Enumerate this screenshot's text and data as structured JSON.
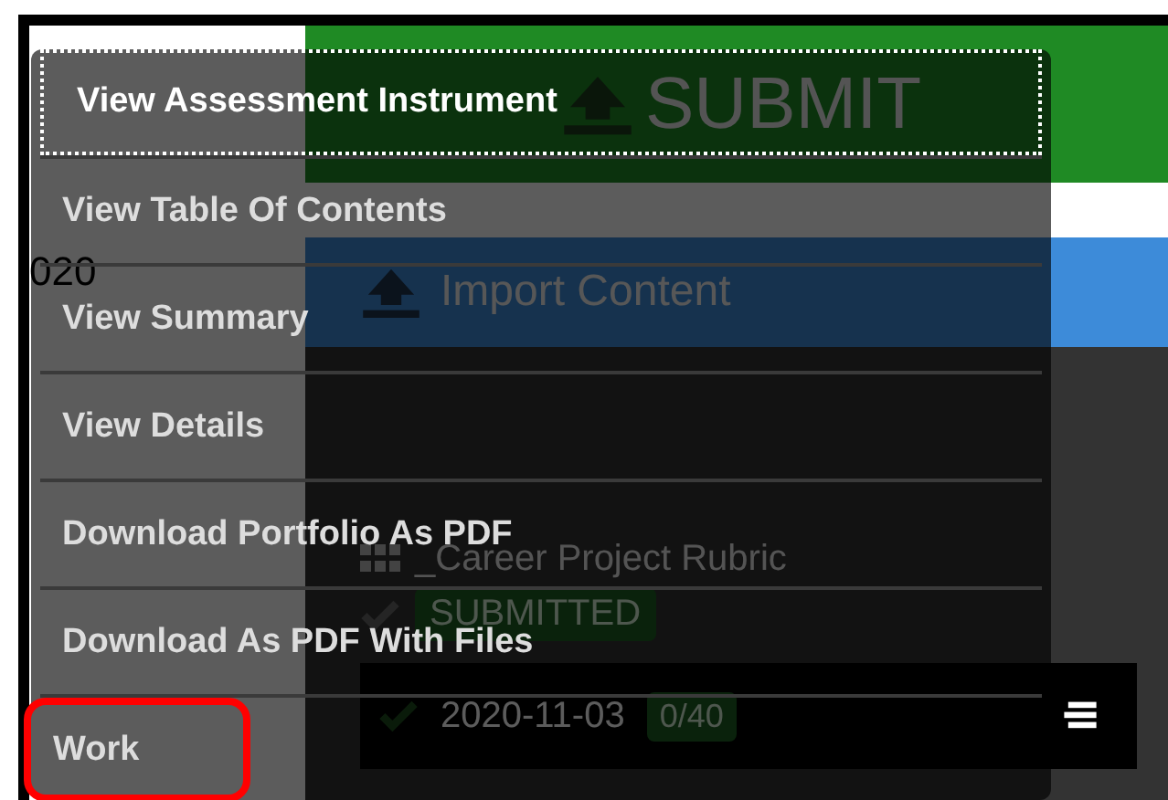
{
  "page": {
    "side_text": "020",
    "submit_button": "SUBMIT",
    "import_button": "Import Content",
    "rubric_title": "_Career Project Rubric",
    "status_badge": "SUBMITTED",
    "entry": {
      "date": "2020-11-03",
      "score": "0/40"
    }
  },
  "menu": {
    "items": [
      {
        "label": "View Assessment Instrument",
        "focused": true,
        "highlighted": false
      },
      {
        "label": "View Table Of Contents",
        "focused": false,
        "highlighted": false
      },
      {
        "label": "View Summary",
        "focused": false,
        "highlighted": false
      },
      {
        "label": "View Details",
        "focused": false,
        "highlighted": false
      },
      {
        "label": "Download Portfolio As PDF",
        "focused": false,
        "highlighted": false
      },
      {
        "label": "Download As PDF With Files",
        "focused": false,
        "highlighted": false
      },
      {
        "label": "Work",
        "focused": false,
        "highlighted": true
      }
    ]
  }
}
